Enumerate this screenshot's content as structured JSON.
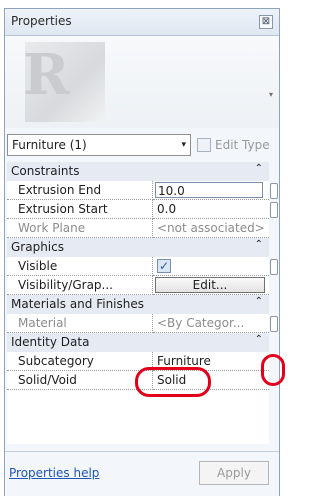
{
  "panel": {
    "title": "Properties",
    "close_glyph": "⊠"
  },
  "preview": {
    "logo_letter": "R",
    "scroll_arrow": "▾"
  },
  "type_selector": {
    "value": "Furniture (1)",
    "arrow": "▾",
    "edit_type_label": "Edit Type"
  },
  "groups": {
    "constraints": {
      "label": "Constraints",
      "chevron": "⌃"
    },
    "graphics": {
      "label": "Graphics",
      "chevron": "⌃"
    },
    "materials": {
      "label": "Materials and Finishes",
      "chevron": "⌃"
    },
    "identity": {
      "label": "Identity Data",
      "chevron": "⌃"
    }
  },
  "properties": {
    "extrusion_end": {
      "name": "Extrusion End",
      "value": "10.0"
    },
    "extrusion_start": {
      "name": "Extrusion Start",
      "value": "0.0"
    },
    "work_plane": {
      "name": "Work Plane",
      "value": "<not associated>"
    },
    "visible": {
      "name": "Visible",
      "checked": "✓"
    },
    "visibility_graphics": {
      "name": "Visibility/Grap...",
      "button": "Edit..."
    },
    "material": {
      "name": "Material",
      "value": "<By Categor..."
    },
    "subcategory": {
      "name": "Subcategory",
      "value": "Furniture"
    },
    "solid_void": {
      "name": "Solid/Void",
      "value": "Solid"
    }
  },
  "footer": {
    "help_link": "Properties help",
    "apply_button": "Apply"
  },
  "colors": {
    "callout": "#e3001b",
    "link": "#1f55b8",
    "group_header": "#e6ebf3"
  }
}
